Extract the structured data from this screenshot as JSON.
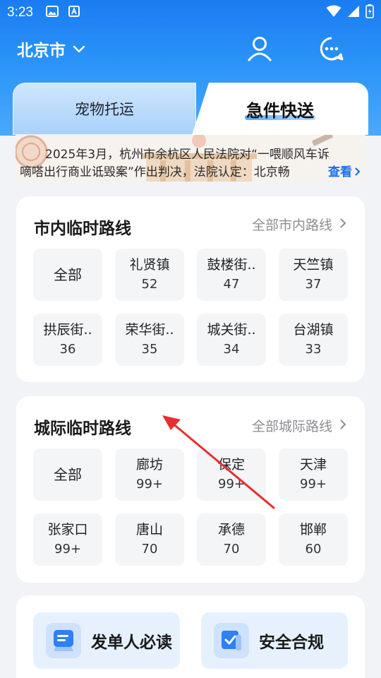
{
  "status_bar": {
    "time": "3:23",
    "icons_left": [
      "image-icon",
      "a-app-icon"
    ],
    "icons_right": [
      "wifi-icon",
      "signal-icon",
      "battery-icon"
    ]
  },
  "header": {
    "city": "北京市",
    "icons": [
      "user-icon",
      "chat-icon"
    ]
  },
  "tabs": {
    "left_label": "宠物托运",
    "right_label": "急件快送",
    "active": "急件快送"
  },
  "notice": {
    "line1": "2025年3月，杭州市余杭区人民法院对“一喂顺风车诉",
    "line2": "嘀嗒出行商业诋毁案”作出判决，法院认定：北京畅",
    "more": "查看"
  },
  "city_routes": {
    "title": "市内临时路线",
    "link": "全部市内路线",
    "items": [
      {
        "name": "全部",
        "count": ""
      },
      {
        "name": "礼贤镇",
        "count": "52"
      },
      {
        "name": "鼓楼街..",
        "count": "47"
      },
      {
        "name": "天竺镇",
        "count": "37"
      },
      {
        "name": "拱辰街..",
        "count": "36"
      },
      {
        "name": "荣华街..",
        "count": "35"
      },
      {
        "name": "城关街..",
        "count": "34"
      },
      {
        "name": "台湖镇",
        "count": "33"
      }
    ]
  },
  "intercity_routes": {
    "title": "城际临时路线",
    "link": "全部城际路线",
    "items": [
      {
        "name": "全部",
        "count": ""
      },
      {
        "name": "廊坊",
        "count": "99+"
      },
      {
        "name": "保定",
        "count": "99+"
      },
      {
        "name": "天津",
        "count": "99+"
      },
      {
        "name": "张家口",
        "count": "99+"
      },
      {
        "name": "唐山",
        "count": "70"
      },
      {
        "name": "承德",
        "count": "70"
      },
      {
        "name": "邯郸",
        "count": "60"
      }
    ]
  },
  "bottom": {
    "btn1": "发单人必读",
    "btn2": "安全合规"
  },
  "colors": {
    "primary_blue": "#1a7cf2",
    "link_blue": "#1d6ff2",
    "annotation_red": "#e5302f"
  }
}
